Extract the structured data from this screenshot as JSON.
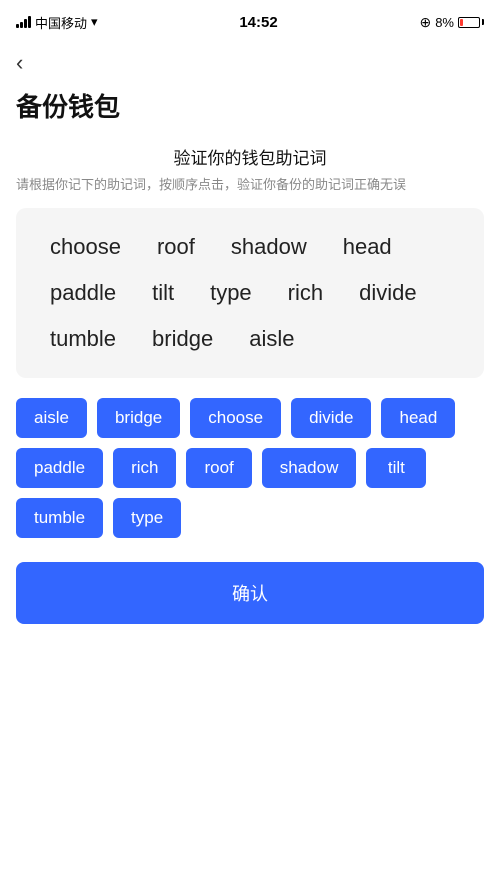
{
  "statusBar": {
    "carrier": "中国移动",
    "time": "14:52",
    "battery": "8%"
  },
  "backButton": {
    "label": "‹"
  },
  "pageTitle": "备份钱包",
  "sectionTitle": "验证你的钱包助记词",
  "sectionDesc": "请根据你记下的助记词，按顺序点击，验证你备份的助记词正确无误",
  "displayWords": [
    "choose",
    "roof",
    "shadow",
    "head",
    "paddle",
    "tilt",
    "type",
    "rich",
    "divide",
    "tumble",
    "bridge",
    "aisle"
  ],
  "wordButtons": [
    "aisle",
    "bridge",
    "choose",
    "divide",
    "head",
    "paddle",
    "rich",
    "roof",
    "shadow",
    "tilt",
    "tumble",
    "type"
  ],
  "confirmButton": "确认",
  "colors": {
    "accent": "#3366ff",
    "bg": "#ffffff",
    "wordAreaBg": "#f5f5f5",
    "textPrimary": "#111111",
    "textSecondary": "#888888"
  }
}
